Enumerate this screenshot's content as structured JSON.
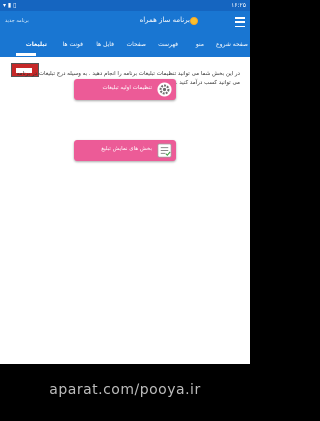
{
  "statusbar": {
    "time": "۱۶:۲۵",
    "icons": "▾ ▮ ▯"
  },
  "appbar": {
    "title": "برنامه ساز همراه",
    "subtitle": "برنامه جدید"
  },
  "tabs": [
    {
      "label": "صفحه شروع",
      "active": false
    },
    {
      "label": "منو",
      "active": false
    },
    {
      "label": "فهرست",
      "active": false
    },
    {
      "label": "صفحات",
      "active": false
    },
    {
      "label": "فایل ها",
      "active": false
    },
    {
      "label": "فونت ها",
      "active": false
    },
    {
      "label": "تبلیغات",
      "active": true
    }
  ],
  "content": {
    "intro_text": "در این بخش شما می توانید تنظیمات تبلیغات برنامه را انجام دهید . به وسیله درج تبلیغات در برنامه می توانید کسب درآمد کنید .",
    "buttons": [
      {
        "label": "تنظیمات اولیه تبلیغات",
        "icon": "gear-icon"
      },
      {
        "label": "بخش های نمایش تبلیغ",
        "icon": "checklist-icon"
      }
    ]
  },
  "watermark": "aparat.com/pooya.ir"
}
